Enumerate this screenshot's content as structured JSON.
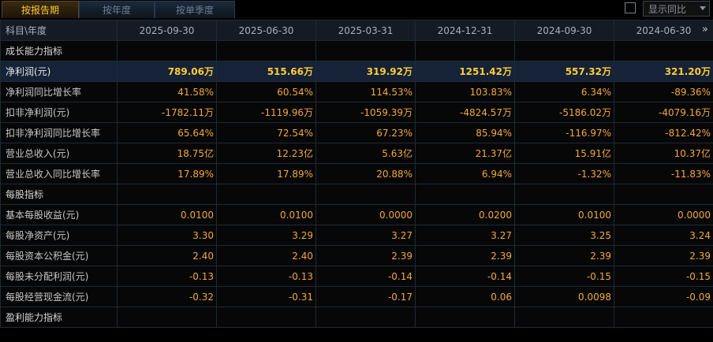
{
  "tabs": [
    "按报告期",
    "按年度",
    "按单季度"
  ],
  "compare_label": "显示同比",
  "more_icon": "»",
  "header": {
    "first": "科目\\年度",
    "dates": [
      "2025-09-30",
      "2025-06-30",
      "2025-03-31",
      "2024-12-31",
      "2024-09-30",
      "2024-06-30"
    ]
  },
  "rows": [
    {
      "type": "section",
      "label": "成长能力指标",
      "values": [
        "",
        "",
        "",
        "",
        "",
        ""
      ]
    },
    {
      "type": "highlight",
      "label": "净利润(元)",
      "values": [
        "789.06万",
        "515.66万",
        "319.92万",
        "1251.42万",
        "557.32万",
        "321.20万"
      ]
    },
    {
      "type": "data",
      "label": "净利润同比增长率",
      "values": [
        "41.58%",
        "60.54%",
        "114.53%",
        "103.83%",
        "6.34%",
        "-89.36%"
      ]
    },
    {
      "type": "data",
      "label": "扣非净利润(元)",
      "values": [
        "-1782.11万",
        "-1119.96万",
        "-1059.39万",
        "-4824.57万",
        "-5186.02万",
        "-4079.16万"
      ]
    },
    {
      "type": "data",
      "label": "扣非净利润同比增长率",
      "values": [
        "65.64%",
        "72.54%",
        "67.23%",
        "85.94%",
        "-116.97%",
        "-812.42%"
      ]
    },
    {
      "type": "data",
      "label": "营业总收入(元)",
      "values": [
        "18.75亿",
        "12.23亿",
        "5.63亿",
        "21.37亿",
        "15.91亿",
        "10.37亿"
      ]
    },
    {
      "type": "data",
      "label": "营业总收入同比增长率",
      "values": [
        "17.89%",
        "17.89%",
        "20.88%",
        "6.94%",
        "-1.32%",
        "-11.83%"
      ]
    },
    {
      "type": "section",
      "label": "每股指标",
      "values": [
        "",
        "",
        "",
        "",
        "",
        ""
      ]
    },
    {
      "type": "data",
      "label": "基本每股收益(元)",
      "values": [
        "0.0100",
        "0.0100",
        "0.0000",
        "0.0200",
        "0.0100",
        "0.0000"
      ]
    },
    {
      "type": "data",
      "label": "每股净资产(元)",
      "values": [
        "3.30",
        "3.29",
        "3.27",
        "3.27",
        "3.25",
        "3.24"
      ]
    },
    {
      "type": "data",
      "label": "每股资本公积金(元)",
      "values": [
        "2.40",
        "2.40",
        "2.39",
        "2.39",
        "2.39",
        "2.39"
      ]
    },
    {
      "type": "data",
      "label": "每股未分配利润(元)",
      "values": [
        "-0.13",
        "-0.13",
        "-0.14",
        "-0.14",
        "-0.15",
        "-0.15"
      ]
    },
    {
      "type": "data",
      "label": "每股经营现金流(元)",
      "values": [
        "-0.32",
        "-0.31",
        "-0.17",
        "0.06",
        "0.0098",
        "-0.09"
      ]
    },
    {
      "type": "section",
      "label": "盈利能力指标",
      "values": [
        "",
        "",
        "",
        "",
        "",
        ""
      ]
    }
  ]
}
